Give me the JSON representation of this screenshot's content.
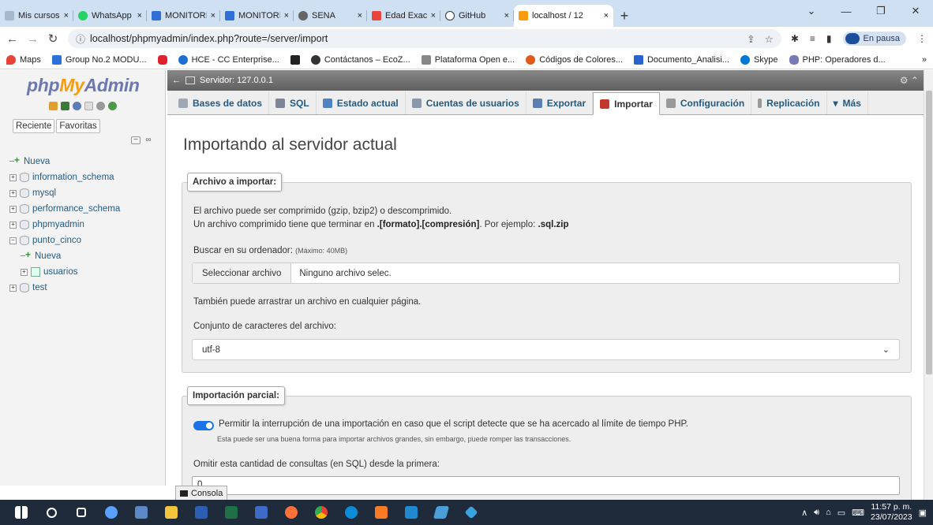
{
  "browser": {
    "tabs": [
      {
        "label": "Mis cursos",
        "icon": "school-icon",
        "color": "#a8b8cc"
      },
      {
        "label": "WhatsApp",
        "icon": "whatsapp-icon",
        "color": "#25d366"
      },
      {
        "label": "MONITORIA",
        "icon": "drive-icon",
        "color": "#2f6fd6"
      },
      {
        "label": "MONITORIA",
        "icon": "drive-icon",
        "color": "#2f6fd6"
      },
      {
        "label": "SENA",
        "icon": "sena-icon",
        "color": "#666666"
      },
      {
        "label": "Edad Exacta",
        "icon": "calculator-icon",
        "color": "#e8463a"
      },
      {
        "label": "GitHub",
        "icon": "github-icon",
        "color": "#ffffff"
      },
      {
        "label": "localhost / 12",
        "icon": "phpmyadmin-icon",
        "color": "#f89c0e",
        "active": true
      }
    ],
    "close_glyph": "×",
    "new_tab": "+",
    "url": "localhost/phpmyadmin/index.php?route=/server/import",
    "profile_status": "En pausa",
    "bookmarks": [
      {
        "label": "Maps",
        "color": "#e84335"
      },
      {
        "label": "Group No.2 MODU...",
        "color": "#2b70d6"
      },
      {
        "label": "",
        "color": "#e0202a"
      },
      {
        "label": "HCE - CC Enterprise...",
        "color": "#1f6fd0"
      },
      {
        "label": "",
        "color": "#222222"
      },
      {
        "label": "Contáctanos – EcoZ...",
        "color": "#333333"
      },
      {
        "label": "Plataforma Open e...",
        "color": "#888888"
      },
      {
        "label": "Códigos de Colores...",
        "color": "#e05a1a"
      },
      {
        "label": "Documento_Analisi...",
        "color": "#2a63d0"
      },
      {
        "label": "Skype",
        "color": "#0078d4"
      },
      {
        "label": "PHP: Operadores d...",
        "color": "#777bb3"
      }
    ],
    "bookmarks_more": "»"
  },
  "pma": {
    "logo": {
      "php": "php",
      "my": "My",
      "admin": "Admin"
    },
    "nav_tabs": [
      "Reciente",
      "Favoritas"
    ],
    "tree": [
      {
        "label": "Nueva",
        "type": "new",
        "level": 0
      },
      {
        "label": "information_schema",
        "type": "db",
        "level": 0
      },
      {
        "label": "mysql",
        "type": "db",
        "level": 0
      },
      {
        "label": "performance_schema",
        "type": "db",
        "level": 0
      },
      {
        "label": "phpmyadmin",
        "type": "db",
        "level": 0
      },
      {
        "label": "punto_cinco",
        "type": "db",
        "level": 0,
        "expanded": true
      },
      {
        "label": "Nueva",
        "type": "new",
        "level": 1
      },
      {
        "label": "usuarios",
        "type": "table",
        "level": 1
      },
      {
        "label": "test",
        "type": "db",
        "level": 0
      }
    ],
    "server_label": "Servidor: 127.0.0.1",
    "menu": [
      {
        "label": "Bases de datos",
        "color": "#9fa7b5"
      },
      {
        "label": "SQL",
        "color": "#7d8696"
      },
      {
        "label": "Estado actual",
        "color": "#4e82c2"
      },
      {
        "label": "Cuentas de usuarios",
        "color": "#8a98ad"
      },
      {
        "label": "Exportar",
        "color": "#5c7fb0"
      },
      {
        "label": "Importar",
        "color": "#c0392b",
        "active": true
      },
      {
        "label": "Configuración",
        "color": "#999999"
      },
      {
        "label": "Replicación",
        "color": "#999999"
      },
      {
        "label": "Más",
        "color": "#333333"
      }
    ],
    "page_title": "Importando al servidor actual",
    "import_file": {
      "legend": "Archivo a importar:",
      "line1": "El archivo puede ser comprimido (gzip, bzip2) o descomprimido.",
      "line2_pre": "Un archivo comprimido tiene que terminar en ",
      "line2_fmt": ".[formato].[compresión]",
      "line2_mid": ". Por ejemplo: ",
      "line2_ex": ".sql.zip",
      "browse_label": "Buscar en su ordenador:",
      "max_size": "(Máximo: 40MB)",
      "file_button": "Seleccionar archivo",
      "file_status": "Ninguno archivo selec.",
      "drag_text": "También puede arrastrar un archivo en cualquier página.",
      "charset_label": "Conjunto de caracteres del archivo:",
      "charset_value": "utf-8"
    },
    "partial": {
      "legend": "Importación parcial:",
      "allow_interrupt": "Permitir la interrupción de una importación en caso que el script detecte que se ha acercado al límite de tiempo PHP.",
      "hint": "Esta puede ser una buena forma para importar archivos grandes, sin embargo, puede romper las transacciones.",
      "skip_label": "Omitir esta cantidad de consultas (en SQL) desde la primera:",
      "skip_value": "0"
    },
    "console": "Consola"
  },
  "taskbar": {
    "apps": [
      {
        "name": "windows-start-icon",
        "color": "#ffffff"
      },
      {
        "name": "search-icon",
        "color": "#ffffff"
      },
      {
        "name": "task-view-icon",
        "color": "#ffffff"
      },
      {
        "name": "chat-icon",
        "color": "#5aa0ff"
      },
      {
        "name": "app-icon",
        "color": "#5b89c8"
      },
      {
        "name": "file-explorer-icon",
        "color": "#f2c53d"
      },
      {
        "name": "word-icon",
        "color": "#2b5fb3"
      },
      {
        "name": "excel-icon",
        "color": "#1e7145"
      },
      {
        "name": "app2-icon",
        "color": "#3d6bc7"
      },
      {
        "name": "firefox-icon",
        "color": "#ff7139"
      },
      {
        "name": "chrome-icon",
        "color": "#34a853"
      },
      {
        "name": "edge-icon",
        "color": "#0c8bd6"
      },
      {
        "name": "xampp-icon",
        "color": "#fb7a24"
      },
      {
        "name": "vscode-icon",
        "color": "#1f8ad2"
      },
      {
        "name": "app3-icon",
        "color": "#4a9fd8"
      },
      {
        "name": "git-icon",
        "color": "#3aa0e0"
      }
    ],
    "time": "11:57 p. m.",
    "date": "23/07/2023"
  }
}
